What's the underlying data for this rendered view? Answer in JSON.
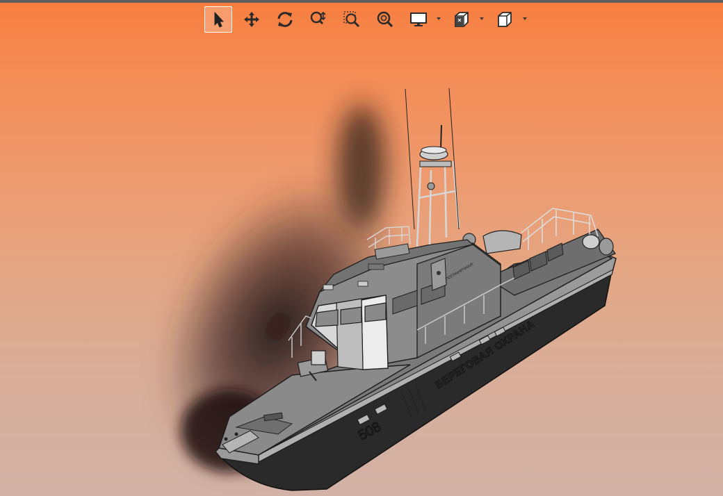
{
  "toolbar": {
    "tools": [
      {
        "id": "select",
        "icon": "select-arrow-icon",
        "active": true
      },
      {
        "id": "pan",
        "icon": "pan-move-icon",
        "active": false
      },
      {
        "id": "rotate",
        "icon": "rotate-icon",
        "active": false
      },
      {
        "id": "zoom-dynamic",
        "icon": "zoom-dynamic-icon",
        "active": false
      },
      {
        "id": "zoom-window",
        "icon": "zoom-window-icon",
        "active": false
      },
      {
        "id": "zoom-fit",
        "icon": "zoom-fit-icon",
        "active": false
      },
      {
        "id": "display",
        "icon": "display-monitor-icon",
        "active": false,
        "dropdown": true
      },
      {
        "id": "render-mode",
        "icon": "render-mode-icon",
        "active": false,
        "dropdown": true
      },
      {
        "id": "view-cube",
        "icon": "view-cube-icon",
        "active": false,
        "dropdown": true
      }
    ]
  },
  "model": {
    "hull_number": "508",
    "side_text": "БЕРЕГОВАЯ ОХРАНА",
    "small_text": "ПОГРАНИЧНАЯ"
  },
  "colors": {
    "bg_top": "#f77d3f",
    "bg_bottom": "#d2b2a6",
    "hull": "#8e8e8e",
    "hull_dark": "#5d5d5d",
    "deck": "#777777",
    "cabin_light": "#e8e8e8",
    "outline": "#1e1e1e"
  }
}
